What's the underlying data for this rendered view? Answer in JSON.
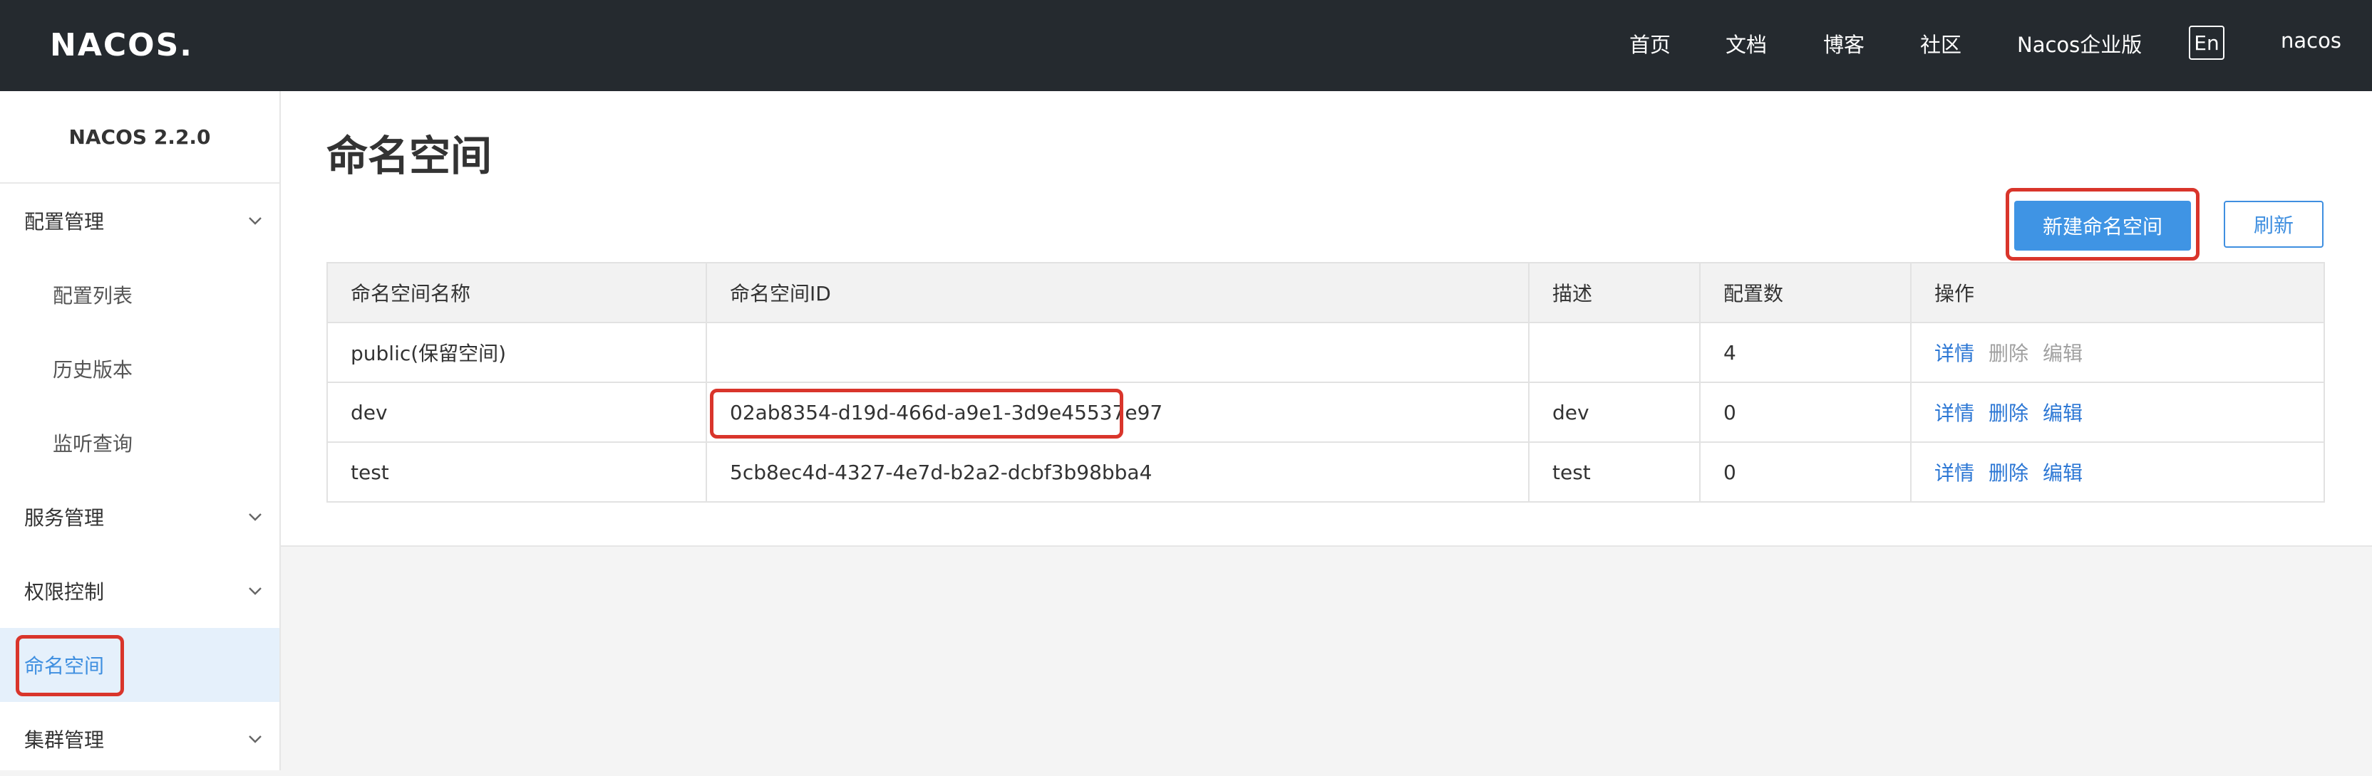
{
  "header": {
    "logo_text": "NACOS.",
    "nav": [
      "首页",
      "文档",
      "博客",
      "社区",
      "Nacos企业版"
    ],
    "lang": "En",
    "user": "nacos"
  },
  "sidebar": {
    "version": "NACOS 2.2.0",
    "items": [
      {
        "label": "配置管理",
        "type": "group",
        "expanded": true
      },
      {
        "label": "配置列表",
        "type": "sub"
      },
      {
        "label": "历史版本",
        "type": "sub"
      },
      {
        "label": "监听查询",
        "type": "sub"
      },
      {
        "label": "服务管理",
        "type": "group"
      },
      {
        "label": "权限控制",
        "type": "group"
      },
      {
        "label": "命名空间",
        "type": "link",
        "active": true
      },
      {
        "label": "集群管理",
        "type": "group"
      }
    ]
  },
  "main": {
    "title": "命名空间",
    "create_button": "新建命名空间",
    "refresh_button": "刷新",
    "table": {
      "headers": [
        "命名空间名称",
        "命名空间ID",
        "描述",
        "配置数",
        "操作"
      ],
      "rows": [
        {
          "name": "public(保留空间)",
          "id": "",
          "desc": "",
          "count": "4",
          "ops": [
            "详情",
            "删除",
            "编辑"
          ],
          "ops_disabled": [
            false,
            true,
            true
          ]
        },
        {
          "name": "dev",
          "id": "02ab8354-d19d-466d-a9e1-3d9e45537e97",
          "desc": "dev",
          "count": "0",
          "ops": [
            "详情",
            "删除",
            "编辑"
          ],
          "ops_disabled": [
            false,
            false,
            false
          ]
        },
        {
          "name": "test",
          "id": "5cb8ec4d-4327-4e7d-b2a2-dcbf3b98bba4",
          "desc": "test",
          "count": "0",
          "ops": [
            "详情",
            "删除",
            "编辑"
          ],
          "ops_disabled": [
            false,
            false,
            false
          ]
        }
      ]
    }
  },
  "colors": {
    "topbar": "#252a2f",
    "primary": "#3f94e4",
    "link": "#2c77d4",
    "highlight": "#d9352b",
    "active_bg": "#e5f0fb"
  }
}
